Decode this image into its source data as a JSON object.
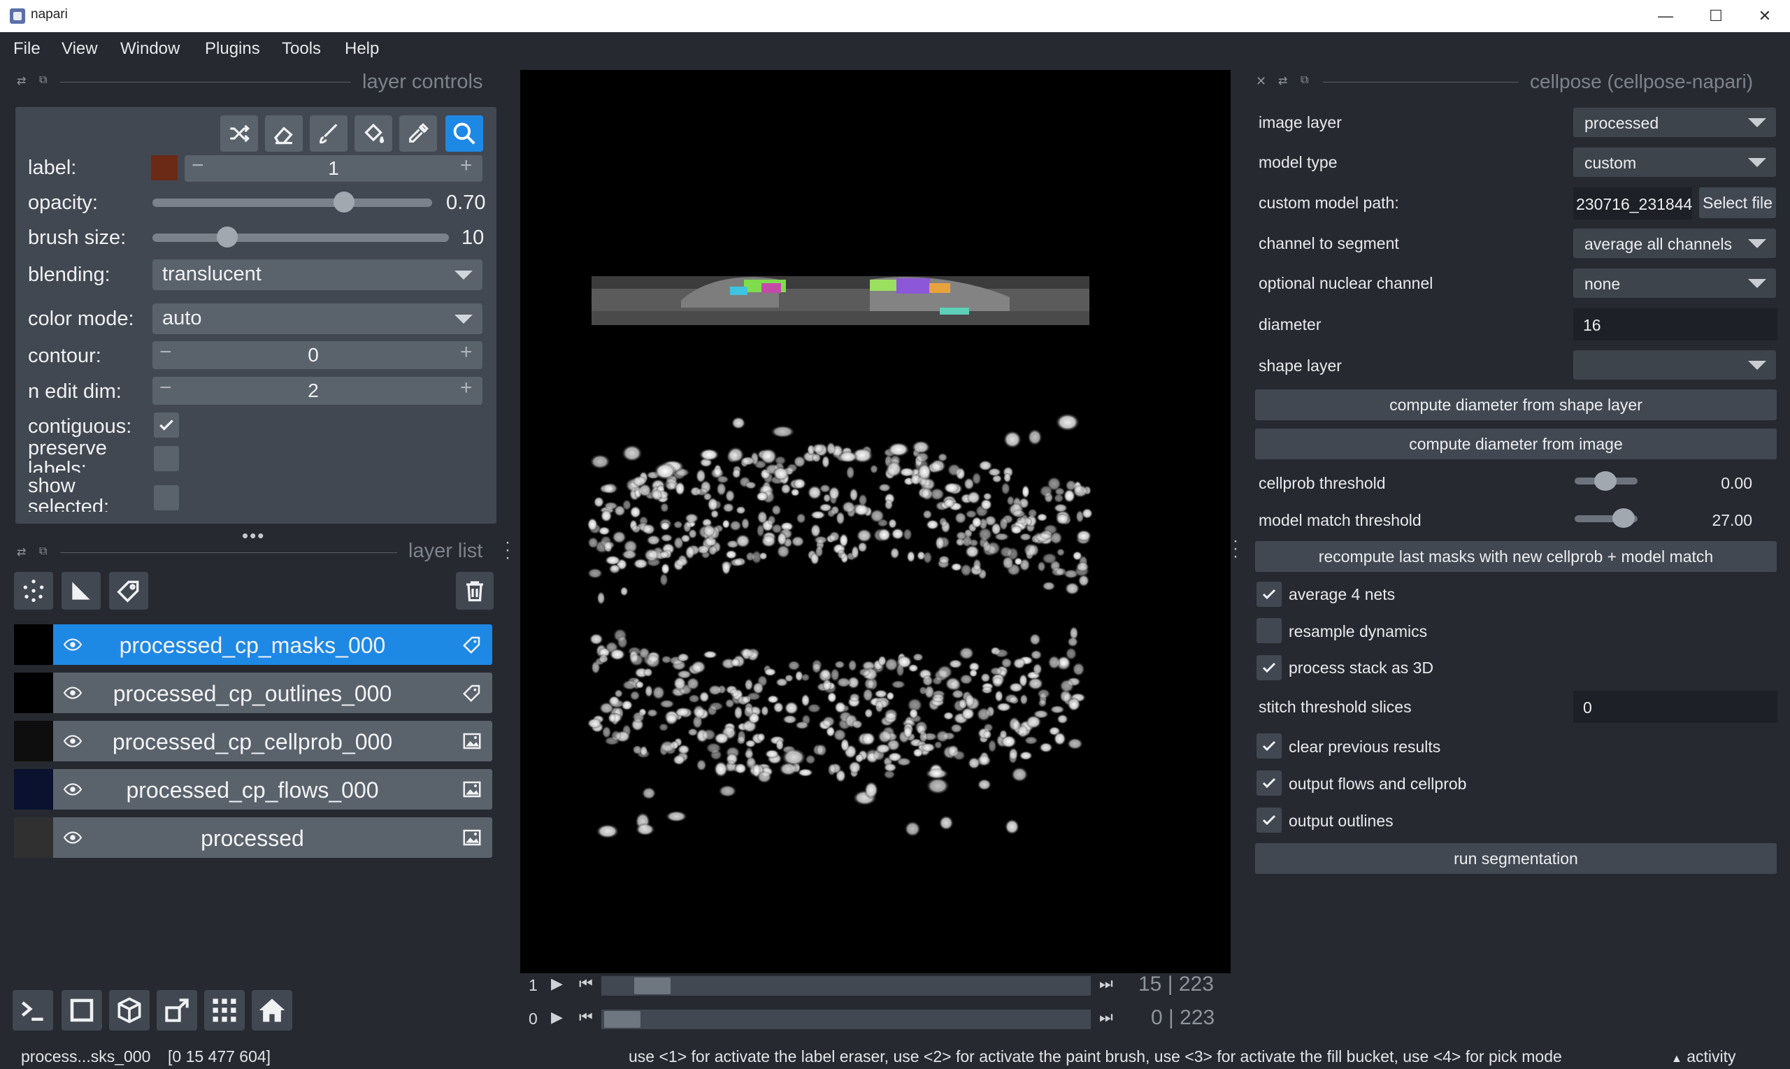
{
  "window": {
    "title": "napari",
    "minimize": "—",
    "maximize": "☐",
    "close": "✕"
  },
  "menu": [
    "File",
    "View",
    "Window",
    "Plugins",
    "Tools",
    "Help"
  ],
  "layer_controls": {
    "title": "layer controls",
    "label_label": "label:",
    "label_value": "1",
    "label_color": "#6a2a16",
    "opacity_label": "opacity:",
    "opacity_value": "0.70",
    "opacity_fraction": 0.7,
    "brush_label": "brush size:",
    "brush_value": "10",
    "blending_label": "blending:",
    "blending_value": "translucent",
    "color_mode_label": "color mode:",
    "color_mode_value": "auto",
    "contour_label": "contour:",
    "contour_value": "0",
    "n_edit_dim_label": "n edit dim:",
    "n_edit_dim_value": "2",
    "contiguous_label": "contiguous:",
    "preserve_label": "preserve labels:",
    "show_selected_label": "show selected:",
    "minus": "−",
    "plus": "+"
  },
  "layer_list": {
    "title": "layer list",
    "layers": [
      {
        "name": "processed_cp_masks_000",
        "type": "labels"
      },
      {
        "name": "processed_cp_outlines_000",
        "type": "labels"
      },
      {
        "name": "processed_cp_cellprob_000",
        "type": "image"
      },
      {
        "name": "processed_cp_flows_000",
        "type": "image"
      },
      {
        "name": "processed",
        "type": "image"
      }
    ]
  },
  "dims": [
    {
      "axis_label": "1",
      "current": "15",
      "total": "223"
    },
    {
      "axis_label": "0",
      "current": "0",
      "total": "223"
    }
  ],
  "cellpose": {
    "title": "cellpose (cellpose-napari)",
    "image_layer_label": "image layer",
    "image_layer_value": "processed",
    "model_type_label": "model type",
    "model_type_value": "custom",
    "custom_path_label": "custom model path:",
    "custom_path_value": "230716_231844",
    "select_file": "Select file",
    "channel_label": "channel to segment",
    "channel_value": "average all channels",
    "nuclear_label": "optional nuclear channel",
    "nuclear_value": "none",
    "diameter_label": "diameter",
    "diameter_value": "16",
    "shape_layer_label": "shape layer",
    "shape_layer_value": "",
    "compute_from_shape": "compute diameter from shape layer",
    "compute_from_image": "compute diameter from image",
    "cellprob_label": "cellprob threshold",
    "cellprob_value": "0.00",
    "model_match_label": "model match threshold",
    "model_match_value": "27.00",
    "recompute": "recompute last masks with new cellprob + model match",
    "average_nets": "average 4 nets",
    "resample": "resample dynamics",
    "process_3d": "process stack as 3D",
    "stitch_label": "stitch threshold slices",
    "stitch_value": "0",
    "clear_previous": "clear previous results",
    "output_flows": "output flows and cellprob",
    "output_outlines": "output outlines",
    "run": "run segmentation"
  },
  "status": {
    "layer": "process...sks_000",
    "coords": "[0 15 477 604]",
    "help": "use <1> for activate the label eraser, use <2> for activate the paint brush, use <3> for activate the fill bucket, use <4> for pick mode",
    "activity": "activity",
    "activity_arrow": "▲"
  }
}
